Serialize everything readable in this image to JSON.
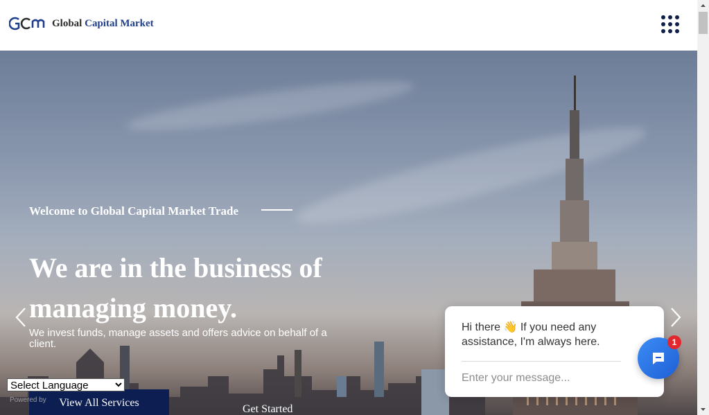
{
  "header": {
    "logo_word1": "Global",
    "logo_word2": "Capital Market",
    "menu_icon": "grid-dots-icon"
  },
  "hero": {
    "subtitle": "Welcome to Global Capital Market Trade",
    "title": "We are in the business of managing money.",
    "description": "We invest funds, manage assets and offers advice on behalf of a client.",
    "btn_services": "View All Services",
    "btn_started": "Get Started"
  },
  "translate": {
    "selected": "Select Language",
    "powered_by": "Powered by"
  },
  "chat": {
    "greeting": "Hi there 👋 If you need any assistance, I'm always here.",
    "placeholder": "Enter your message...",
    "badge_count": "1"
  },
  "colors": {
    "brand_navy": "#0d1f52",
    "chat_blue": "#1f5fd6",
    "badge_red": "#e0282e"
  }
}
